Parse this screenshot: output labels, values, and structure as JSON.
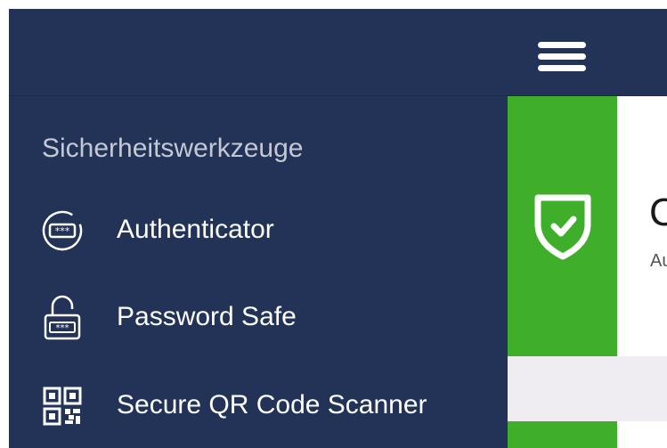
{
  "header": {
    "menu_icon": "hamburger-menu-icon"
  },
  "drawer": {
    "section_heading": "Sicherheitswerkzeuge",
    "items": [
      {
        "label": "Authenticator",
        "icon": "authenticator-icon"
      },
      {
        "label": "Password Safe",
        "icon": "padlock-icon"
      },
      {
        "label": "Secure QR Code Scanner",
        "icon": "qr-code-icon"
      }
    ]
  },
  "status_card": {
    "title": "C",
    "subtitle": "Au",
    "icon": "shield-check-icon"
  },
  "colors": {
    "navy": "#223357",
    "green": "#3fae2a",
    "lavender": "#efedf2"
  }
}
